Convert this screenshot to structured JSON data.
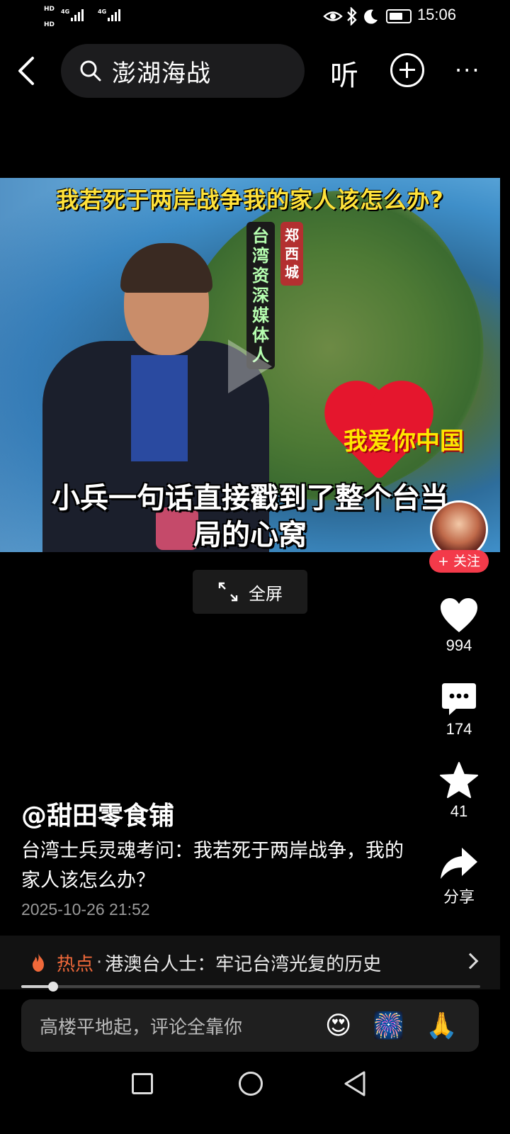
{
  "status_bar": {
    "network_1": "HD",
    "network_2": "HD",
    "sig1_label": "4G",
    "sig2_label": "4G",
    "time": "15:06"
  },
  "top_nav": {
    "search_query": "澎湖海战",
    "listen_label": "听",
    "more_label": "···"
  },
  "video": {
    "title_overlay": "我若死于两岸战争我的家人该怎么办?",
    "tag_vertical": "台湾资深媒体人",
    "tag_name": "郑西城",
    "love_text": "我爱你中国",
    "subtitle_line1": "小兵一句话直接戳到了整个台当",
    "subtitle_line2": "局的心窝"
  },
  "fullscreen_label": "全屏",
  "actions": {
    "follow_label": "+ 关注",
    "likes": "994",
    "comments": "174",
    "favorites": "41",
    "share_label": "分享"
  },
  "caption": {
    "author": "@甜田零食铺",
    "description": "台湾士兵灵魂考问：我若死于两岸战争，我的家人该怎么办？",
    "date": "2025-10-26 21:52"
  },
  "hot": {
    "label": "热点",
    "separator": "·",
    "text": "港澳台人士：牢记台湾光复的历史"
  },
  "progress": {
    "value": 0.07
  },
  "comment_bar": {
    "placeholder": "高楼平地起，评论全靠你",
    "emoji_1": "😍",
    "emoji_2": "🎆",
    "emoji_3": "🙏"
  },
  "colors": {
    "accent_red": "#f33a4a",
    "hot_orange": "#f0693a",
    "title_yellow": "#ffe23a"
  },
  "icons": [
    "back-arrow-icon",
    "search-icon",
    "add-icon",
    "heart-icon",
    "comment-icon",
    "star-icon",
    "share-icon",
    "fire-icon",
    "chevron-right-icon",
    "expand-icon"
  ]
}
